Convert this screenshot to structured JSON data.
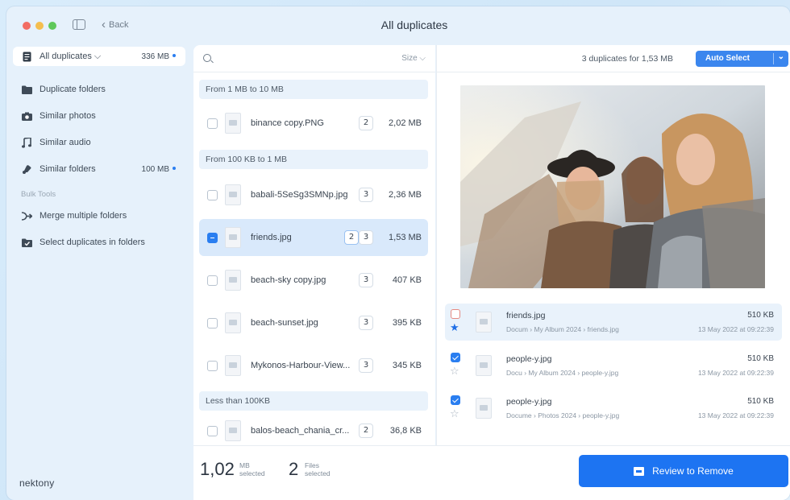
{
  "window": {
    "title": "All duplicates",
    "back_label": "Back"
  },
  "sidebar": {
    "items": [
      {
        "label": "All duplicates ⌵",
        "size": "336 MB",
        "icon": "document-icon",
        "active": true
      },
      {
        "label": "Duplicate folders",
        "icon": "folder-icon"
      },
      {
        "label": "Similar photos",
        "icon": "camera-icon"
      },
      {
        "label": "Similar audio",
        "icon": "music-note-icon"
      },
      {
        "label": "Similar folders",
        "size": "100 MB",
        "icon": "folder-sync-icon"
      }
    ],
    "section_label": "Bulk Tools",
    "tools": [
      {
        "label": "Merge multiple folders",
        "icon": "merge-icon"
      },
      {
        "label": "Select duplicates in folders",
        "icon": "folder-check-icon"
      }
    ],
    "brand": "nektony"
  },
  "list": {
    "sort_label": "Size ⌵",
    "groups": [
      {
        "label": "From 1 MB to 10 MB"
      },
      {
        "label": "From 100 KB to 1 MB"
      },
      {
        "label": "Less than 100KB"
      }
    ],
    "files": [
      {
        "name": "binance copy.PNG",
        "count": "2",
        "size": "2,02 MB"
      },
      {
        "name": "babali-5SeSg3SMNp.jpg",
        "count": "3",
        "size": "2,36 MB"
      },
      {
        "name": "friends.jpg",
        "count_selected": "2",
        "count": "3",
        "size": "1,53 MB"
      },
      {
        "name": "beach-sky copy.jpg",
        "count": "3",
        "size": "407 KB"
      },
      {
        "name": "beach-sunset.jpg",
        "count": "3",
        "size": "395 KB"
      },
      {
        "name": "Mykonos-Harbour-View...",
        "count": "3",
        "size": "345 KB"
      },
      {
        "name": "balos-beach_chania_cr...",
        "count": "2",
        "size": "36,8 KB"
      }
    ]
  },
  "detail": {
    "summary": "3 duplicates for 1,53 MB",
    "auto_select_label": "Auto Select",
    "duplicates": [
      {
        "name": "friends.jpg",
        "path": "Docum › My Album 2024 › friends.jpg",
        "size": "510 KB",
        "date": "13 May 2022 at 09:22:39"
      },
      {
        "name": "people-y.jpg",
        "path": "Docu › My Album 2024 › people-y.jpg",
        "size": "510 KB",
        "date": "13 May 2022 at 09:22:39"
      },
      {
        "name": "people-y.jpg",
        "path": "Docume › Photos 2024 › people-y.jpg",
        "size": "510 KB",
        "date": "13 May 2022 at 09:22:39"
      }
    ]
  },
  "footer": {
    "size_value": "1,02",
    "size_unit": "MB",
    "size_caption": "selected",
    "files_value": "2",
    "files_unit": "Files",
    "files_caption": "selected",
    "review_label": "Review to Remove"
  },
  "colors": {
    "accent": "#1d74f2",
    "selection": "#d9e9fb",
    "sidebar_bg": "#e6f1fb"
  }
}
